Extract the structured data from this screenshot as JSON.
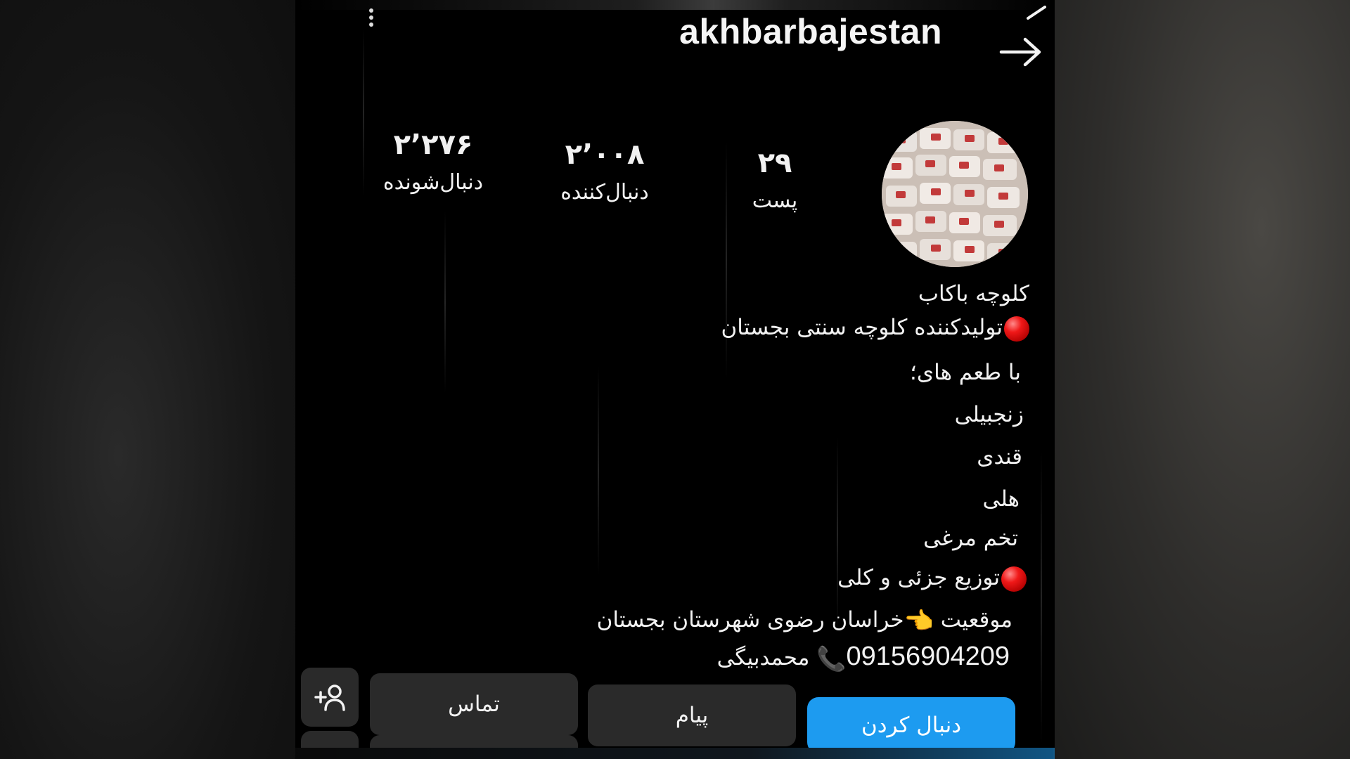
{
  "header": {
    "username": "akhbarbajestan"
  },
  "profile": {
    "avatar_icon": "product-photo-avatar",
    "stats": [
      {
        "key": "posts",
        "value": "۲۹",
        "label": "پست"
      },
      {
        "key": "followers",
        "value": "۲٬۰۰۸",
        "label": "دنبال‌کننده"
      },
      {
        "key": "following",
        "value": "۲٬۲۷۶",
        "label": "دنبال‌شونده"
      }
    ]
  },
  "bio": {
    "name": "کلوچه باکاب",
    "line1": "تولیدکننده کلوچه سنتی بجستان",
    "line2": "با طعم های؛",
    "line3": "زنجبیلی",
    "line4": "قندی",
    "line5": "هلی",
    "line6": "تخم مرغی",
    "line7": "توزیع جزئی و کلی",
    "location_label": "موقعیت",
    "location_value": "خراسان رضوی شهرستان بجستان",
    "phone": "09156904209",
    "contact_name": "محمدبیگی"
  },
  "actions": {
    "follow_label": "دنبال کردن",
    "message_label": "پیام",
    "contact_label": "تماس"
  },
  "colors": {
    "accent": "#1d9bf0",
    "background": "#000000",
    "button_bg": "#2a2a2a",
    "red_dot": "#e01010"
  }
}
